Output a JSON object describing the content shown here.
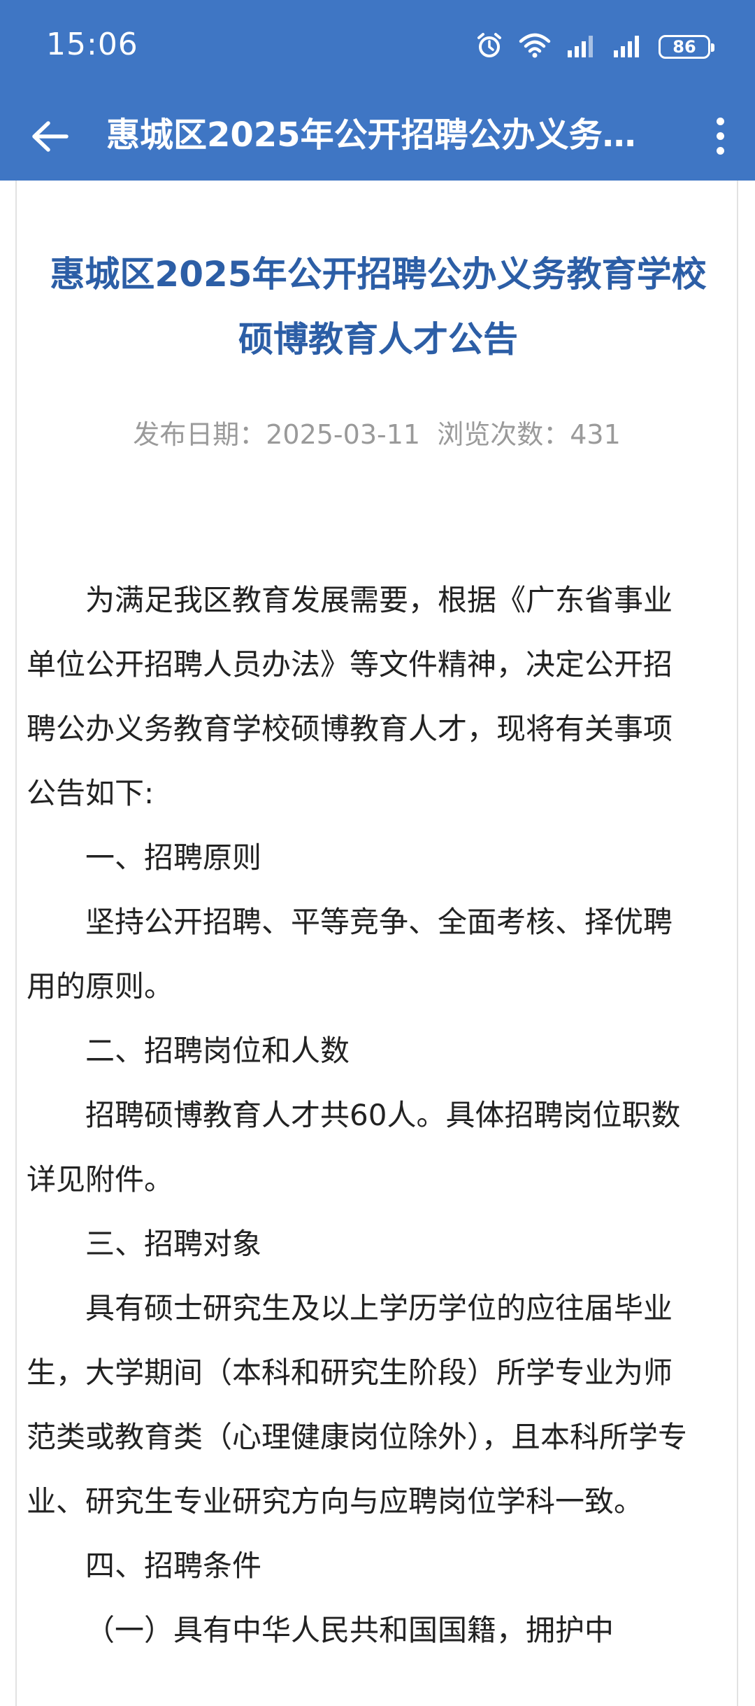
{
  "status_bar": {
    "time": "15:06",
    "battery": "86",
    "icons": [
      "alarm-icon",
      "wifi-icon",
      "signal-icon",
      "signal-icon",
      "battery-icon"
    ]
  },
  "nav": {
    "title": "惠城区2025年公开招聘公办义务...",
    "back_icon": "back-arrow-icon",
    "more_icon": "more-vertical-icon"
  },
  "article": {
    "title_line1": "惠城区2025年公开招聘公办义务教育学校",
    "title_line2": "硕博教育人才公告",
    "meta": {
      "date_label": "发布日期：",
      "date": "2025-03-11",
      "views_label": "浏览次数：",
      "views": "431"
    },
    "paragraphs": [
      "为满足我区教育发展需要，根据《广东省事业单位公开招聘人员办法》等文件精神，决定公开招聘公办义务教育学校硕博教育人才，现将有关事项公告如下:",
      "一、招聘原则",
      "坚持公开招聘、平等竞争、全面考核、择优聘用的原则。",
      "二、招聘岗位和人数",
      "招聘硕博教育人才共60人。具体招聘岗位职数详见附件。",
      "三、招聘对象",
      "具有硕士研究生及以上学历学位的应往届毕业生，大学期间（本科和研究生阶段）所学专业为师范类或教育类（心理健康岗位除外），且本科所学专业、研究生专业研究方向与应聘岗位学科一致。",
      "四、招聘条件",
      "（一）具有中华人民共和国国籍，拥护中"
    ]
  },
  "colors": {
    "header_bg": "#3f76c4",
    "title_color": "#2c5ea6",
    "meta_color": "#9a9a9a",
    "text_color": "#222222"
  }
}
